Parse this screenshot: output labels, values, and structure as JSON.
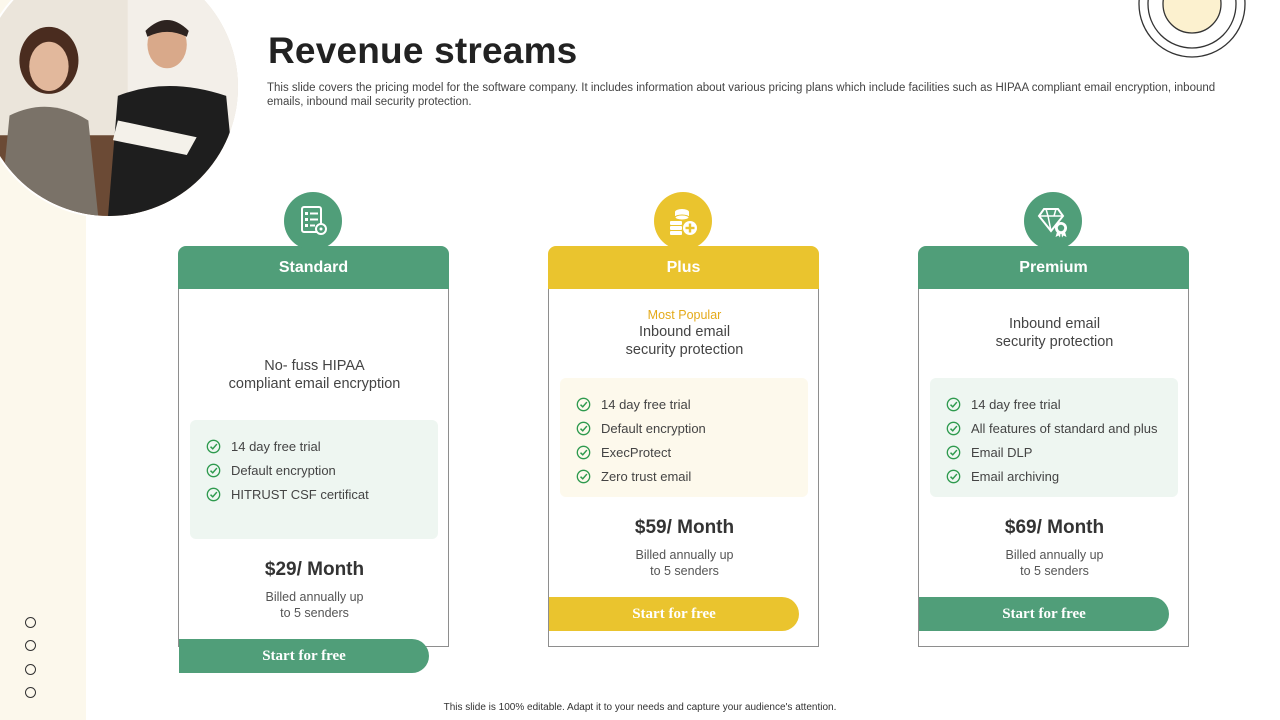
{
  "title": "Revenue streams",
  "description": "This slide covers the pricing model for the software company. It includes information about various pricing plans which include facilities such as HIPAA compliant email encryption, inbound emails, inbound mail security protection.",
  "footer": "This slide is 100% editable. Adapt it to your needs and capture your audience's attention.",
  "colors": {
    "green": "#509e79",
    "yellow": "#eac42e",
    "side_strip": "#fcf8ec"
  },
  "plans": [
    {
      "name": "Standard",
      "icon": "checklist-gear-icon",
      "badge": "",
      "subtitle_line1": "No- fuss HIPAA",
      "subtitle_line2": "compliant email encryption",
      "features": [
        "14 day free trial",
        "Default encryption",
        "HITRUST CSF certificat"
      ],
      "price": "$29/ Month",
      "billing_line1": "Billed annually up",
      "billing_line2": "to 5 senders",
      "cta": "Start for free"
    },
    {
      "name": "Plus",
      "icon": "coins-plus-icon",
      "badge": "Most Popular",
      "subtitle_line1": "Inbound email",
      "subtitle_line2": "security protection",
      "features": [
        "14 day free trial",
        "Default encryption",
        "ExecProtect",
        "Zero trust email"
      ],
      "price": "$59/ Month",
      "billing_line1": "Billed annually up",
      "billing_line2": "to 5 senders",
      "cta": "Start for free"
    },
    {
      "name": "Premium",
      "icon": "diamond-award-icon",
      "badge": "",
      "subtitle_line1": "Inbound email",
      "subtitle_line2": "security protection",
      "features": [
        "14 day free trial",
        "All features of standard and plus",
        "Email DLP",
        "Email archiving"
      ],
      "price": "$69/ Month",
      "billing_line1": "Billed annually up",
      "billing_line2": "to 5 senders",
      "cta": "Start for free"
    }
  ]
}
